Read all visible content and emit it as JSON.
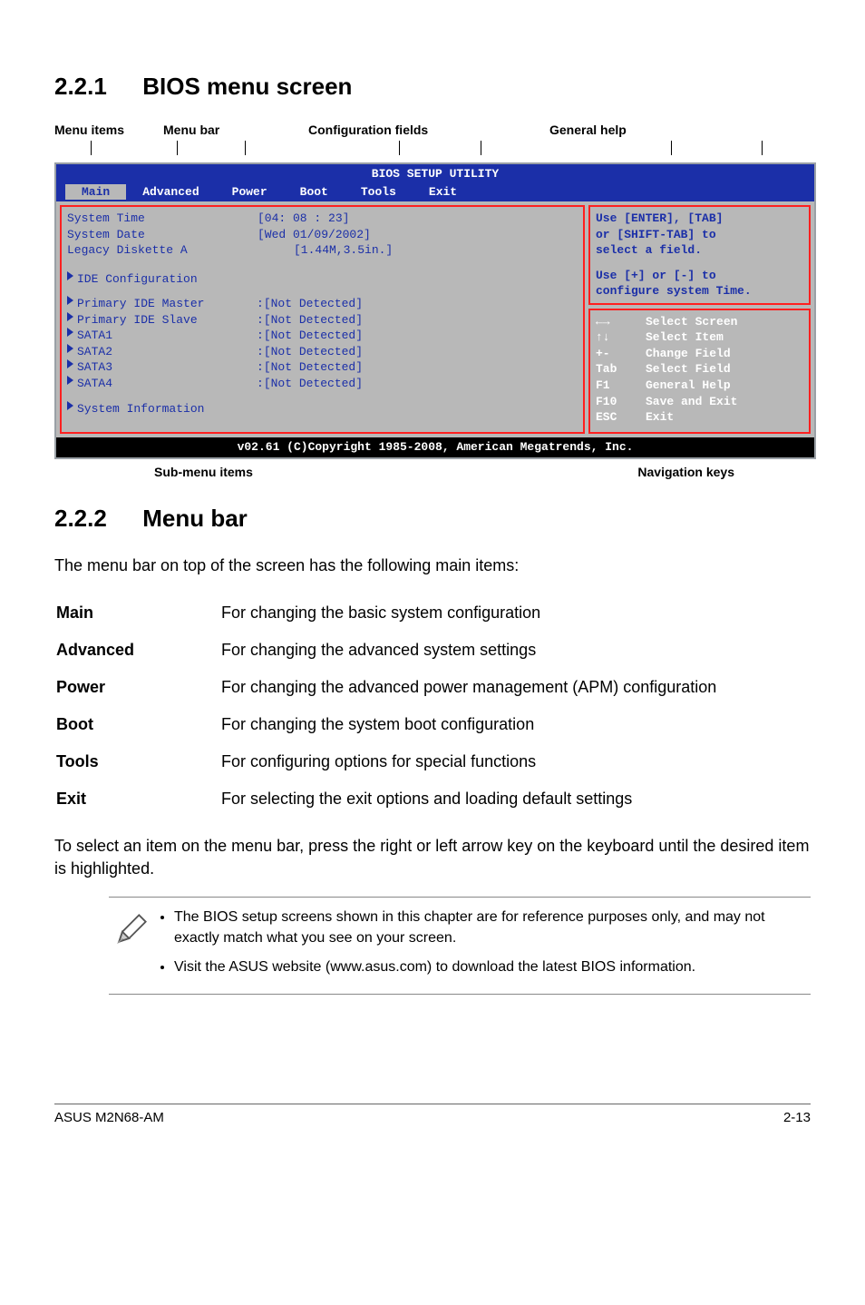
{
  "sec1": {
    "num": "2.2.1",
    "title": "BIOS menu screen"
  },
  "labels": {
    "menu_items": "Menu items",
    "menu_bar": "Menu bar",
    "config_fields": "Configuration fields",
    "general_help": "General help",
    "submenu": "Sub-menu items",
    "navkeys": "Navigation keys"
  },
  "bios": {
    "header": "BIOS SETUP UTILITY",
    "menus": {
      "main": "Main",
      "advanced": "Advanced",
      "power": "Power",
      "boot": "Boot",
      "tools": "Tools",
      "exit": "Exit"
    },
    "items": {
      "system_time": "System Time",
      "system_date": "System Date",
      "legacy": "Legacy Diskette A",
      "ide_config": "IDE Configuration",
      "pim": "Primary IDE Master",
      "pis": "Primary IDE Slave",
      "sata1": "SATA1",
      "sata2": "SATA2",
      "sata3": "SATA3",
      "sata4": "SATA4",
      "sysinfo": "System Information"
    },
    "values": {
      "time": "[04: 08 : 23]",
      "date": "[Wed 01/09/2002]",
      "legacy": "[1.44M,3.5in.]",
      "nd": "[Not Detected]"
    },
    "help": {
      "l1": "Use [ENTER], [TAB]",
      "l2": "or [SHIFT-TAB] to",
      "l3": "select a field.",
      "l4": "Use [+] or [-] to",
      "l5": "configure system Time."
    },
    "nav": {
      "select_screen": "Select Screen",
      "select_item": "Select Item",
      "change_field": "Change Field",
      "select_field": "Select Field",
      "general_help": "General Help",
      "save_exit": "Save and Exit",
      "exit": "Exit",
      "k_pm": "+-",
      "k_tab": "Tab",
      "k_f1": "F1",
      "k_f10": "F10",
      "k_esc": "ESC"
    },
    "footer": "v02.61 (C)Copyright 1985-2008, American Megatrends, Inc."
  },
  "sec2": {
    "num": "2.2.2",
    "title": "Menu bar"
  },
  "intro2": "The menu bar on top of the screen has the following main items:",
  "defs": {
    "main_t": "Main",
    "main_d": "For changing the basic system configuration",
    "adv_t": "Advanced",
    "adv_d": "For changing the advanced system settings",
    "pow_t": "Power",
    "pow_d": "For changing the advanced power management (APM) configuration",
    "boot_t": "Boot",
    "boot_d": "For changing the system boot configuration",
    "tools_t": "Tools",
    "tools_d": "For configuring options for special functions",
    "exit_t": "Exit",
    "exit_d": "For selecting the exit options and loading default settings"
  },
  "para_select": "To select an item on the menu bar, press the right or left arrow key on the keyboard until the desired item is highlighted.",
  "notes": {
    "n1": "The BIOS setup screens shown in this chapter are for reference purposes only, and may not exactly match what you see on your screen.",
    "n2": "Visit the ASUS website (www.asus.com) to download the latest BIOS information."
  },
  "footer": {
    "left": "ASUS M2N68-AM",
    "right": "2-13"
  }
}
